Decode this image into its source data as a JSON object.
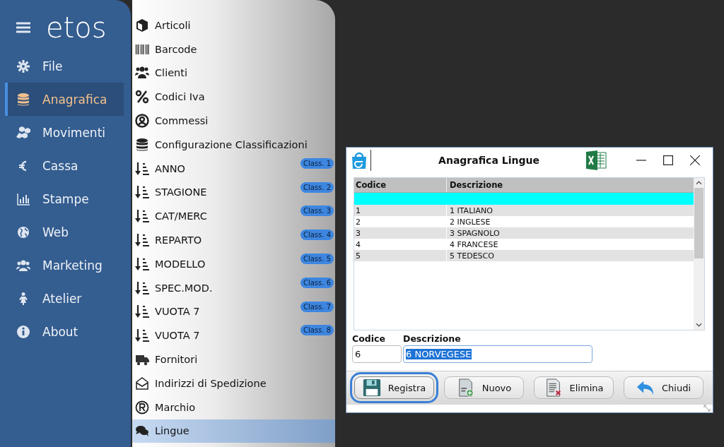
{
  "sidebar": {
    "logo": "etos",
    "items": [
      {
        "label": "File",
        "selected": false
      },
      {
        "label": "Anagrafica",
        "selected": true
      },
      {
        "label": "Movimenti",
        "selected": false
      },
      {
        "label": "Cassa",
        "selected": false
      },
      {
        "label": "Stampe",
        "selected": false
      },
      {
        "label": "Web",
        "selected": false
      },
      {
        "label": "Marketing",
        "selected": false
      },
      {
        "label": "Atelier",
        "selected": false
      },
      {
        "label": "About",
        "selected": false
      }
    ]
  },
  "submenu": {
    "items": [
      {
        "label": "Articoli",
        "selected": false
      },
      {
        "label": "Barcode",
        "selected": false
      },
      {
        "label": "Clienti",
        "selected": false
      },
      {
        "label": "Codici Iva",
        "selected": false
      },
      {
        "label": "Commessi",
        "selected": false
      },
      {
        "label": "Configurazione Classificazioni",
        "selected": false
      },
      {
        "label": "ANNO",
        "badge": "Class. 1",
        "selected": false
      },
      {
        "label": "STAGIONE",
        "badge": "Class. 2",
        "selected": false
      },
      {
        "label": "CAT/MERC",
        "badge": "Class. 3",
        "selected": false
      },
      {
        "label": "REPARTO",
        "badge": "Class. 4",
        "selected": false
      },
      {
        "label": "MODELLO",
        "badge": "Class. 5",
        "selected": false
      },
      {
        "label": "SPEC.MOD.",
        "badge": "Class. 6",
        "selected": false
      },
      {
        "label": "VUOTA 7",
        "badge": "Class. 7",
        "selected": false
      },
      {
        "label": "VUOTA 7",
        "badge": "Class. 8",
        "selected": false
      },
      {
        "label": "Fornitori",
        "selected": false
      },
      {
        "label": "Indirizzi di Spedizione",
        "selected": false
      },
      {
        "label": "Marchio",
        "selected": false
      },
      {
        "label": "Lingue",
        "selected": true
      }
    ]
  },
  "dialog": {
    "title": "Anagrafica Lingue",
    "table": {
      "columns": [
        "Codice",
        "Descrizione"
      ],
      "rows": [
        {
          "selected": true
        },
        {
          "cells": [
            "1",
            "1 ITALIANO"
          ],
          "selected": false
        },
        {
          "cells": [
            "2",
            "2 INGLESE"
          ],
          "selected": false
        },
        {
          "cells": [
            "3",
            "3 SPAGNOLO"
          ],
          "selected": false
        },
        {
          "cells": [
            "4",
            "4 FRANCESE"
          ],
          "selected": false
        },
        {
          "cells": [
            "5",
            "5 TEDESCO"
          ],
          "selected": false
        }
      ]
    },
    "fields": [
      {
        "label": "Codice",
        "value": "6",
        "text_selected": false
      },
      {
        "label": "Descrizione",
        "value": "6 NORVEGESE",
        "text_selected": true
      }
    ],
    "buttons": [
      {
        "label": "Registra",
        "focused": true
      },
      {
        "label": "Nuovo",
        "focused": false
      },
      {
        "label": "Elimina",
        "focused": false
      },
      {
        "label": "Chiudi",
        "focused": false
      }
    ]
  }
}
